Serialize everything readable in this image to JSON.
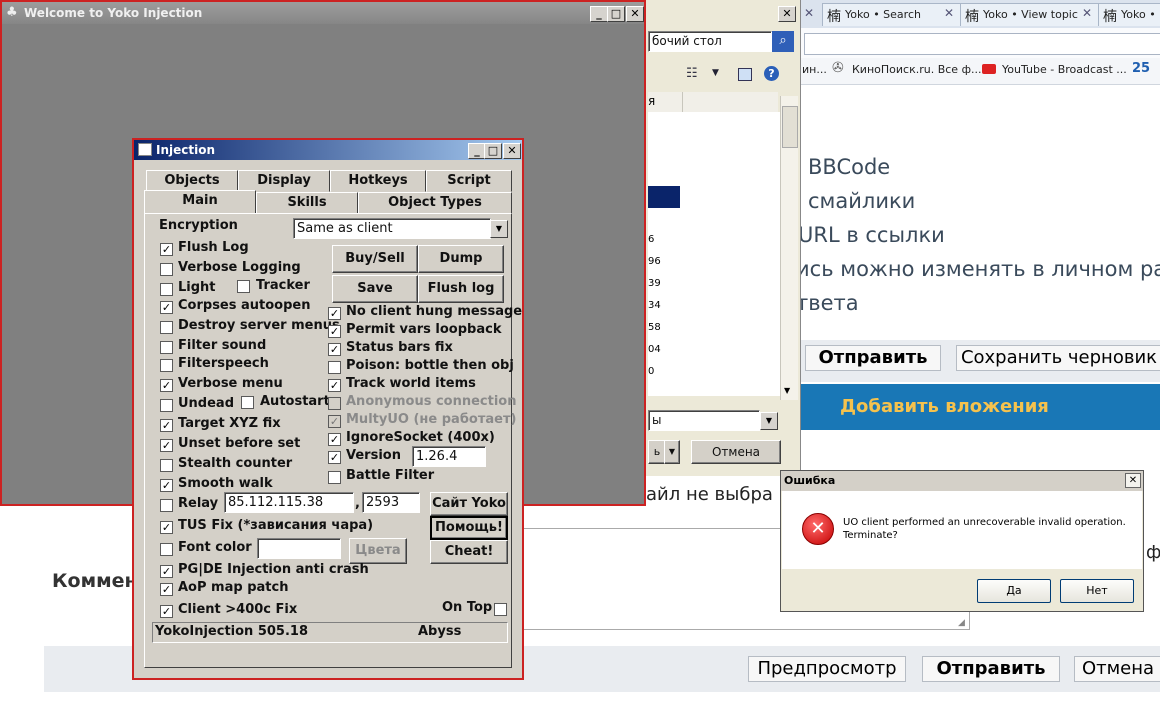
{
  "browser": {
    "tabs": [
      {
        "icon": "楠",
        "label": "Yoko • Search"
      },
      {
        "icon": "楠",
        "label": "Yoko • View topic"
      },
      {
        "icon": "楠",
        "label": "Yoko • "
      }
    ],
    "bookmarks": [
      "ин...",
      "КиноПоиск.ru. Все ф...",
      "YouTube - Broadcast ...",
      "25"
    ],
    "forum_lines": [
      "BBCode",
      "смайлики",
      "URL в ссылки",
      "ись можно изменять в личном раз",
      "твета"
    ],
    "submit_button": "Отправить",
    "draft_button": "Сохранить черновик",
    "attach_label": "Добавить вложения",
    "file_not_selected": "айл не выбра",
    "comment_label": "Коммен",
    "right_edge_text": "ф",
    "preview_button": "Предпросмотр",
    "send_button": "Отправить",
    "cancel_button": "Отмена"
  },
  "explorer": {
    "path_text": "бочий стол",
    "col_header": "я",
    "rows": [
      "6",
      "96",
      "39",
      "34",
      "58",
      "04",
      "0"
    ],
    "dropdown_text": "ы",
    "cancel_button": "Отмена",
    "small_dropdown": "ь"
  },
  "welcome": {
    "title": "Welcome to Yoko Injection"
  },
  "injection": {
    "title": "Injection",
    "tabs_row1": [
      "Objects",
      "Display",
      "Hotkeys",
      "Script"
    ],
    "tabs_row2": [
      "Main",
      "Skills",
      "Object Types"
    ],
    "encryption_label": "Encryption",
    "encryption_value": "Same as client",
    "left_checks": [
      {
        "label": "Flush Log",
        "checked": true
      },
      {
        "label": "Verbose Logging",
        "checked": false
      },
      {
        "label": "Light",
        "checked": false
      },
      {
        "label": "Corpses autoopen",
        "checked": true
      },
      {
        "label": "Destroy server menus",
        "checked": false
      },
      {
        "label": "Filter sound",
        "checked": false
      },
      {
        "label": "Filterspeech",
        "checked": false
      },
      {
        "label": "Verbose menu",
        "checked": true
      },
      {
        "label": "Undead",
        "checked": false
      },
      {
        "label": "Target XYZ fix",
        "checked": true
      },
      {
        "label": "Unset before set",
        "checked": true
      },
      {
        "label": "Stealth counter",
        "checked": false
      },
      {
        "label": "Smooth walk",
        "checked": true
      }
    ],
    "tracker": {
      "label": "Tracker",
      "checked": false
    },
    "autostart": {
      "label": "Autostart",
      "checked": false
    },
    "buttons": {
      "buysell": "Buy/Sell",
      "dump": "Dump",
      "save": "Save",
      "flushlog": "Flush log"
    },
    "right_checks": [
      {
        "label": "No client hung message",
        "checked": true,
        "disabled": false
      },
      {
        "label": "Permit vars loopback",
        "checked": true,
        "disabled": false
      },
      {
        "label": "Status bars fix",
        "checked": true,
        "disabled": false
      },
      {
        "label": "Poison: bottle then obj",
        "checked": false,
        "disabled": false
      },
      {
        "label": "Track world items",
        "checked": true,
        "disabled": false
      },
      {
        "label": "Anonymous connection",
        "checked": false,
        "disabled": true
      },
      {
        "label": "MultyUO (не работает)",
        "checked": true,
        "disabled": true
      },
      {
        "label": "IgnoreSocket (400x)",
        "checked": true,
        "disabled": false
      }
    ],
    "version": {
      "label": "Version",
      "checked": true,
      "value": "1.26.4"
    },
    "battle_filter": {
      "label": "Battle Filter",
      "checked": false
    },
    "relay": {
      "label": "Relay",
      "checked": false,
      "ip": "85.112.115.38",
      "sep": ",",
      "port": "2593"
    },
    "site_button": "Сайт Yoko",
    "help_button": "Помощь!",
    "cheat_button": "Cheat!",
    "tus_fix": {
      "label": "TUS Fix (*зависания чара)",
      "checked": true
    },
    "font_color": {
      "label": "Font color",
      "checked": false,
      "button": "Цвета"
    },
    "pgde": {
      "label": "PG|DE Injection anti crash",
      "checked": true
    },
    "aop": {
      "label": "AoP map patch",
      "checked": true
    },
    "client400": {
      "label": "Client >400c Fix",
      "checked": true
    },
    "on_top": {
      "label": "On Top",
      "checked": false
    },
    "status_left": "YokoInjection 505.18",
    "status_right": "Abyss"
  },
  "error_dialog": {
    "title": "Ошибка",
    "message_line1": "UO client performed an unrecoverable invalid operation.",
    "message_line2": "Terminate?",
    "yes": "Да",
    "no": "Нет"
  },
  "colors": {
    "accent_red": "#cc2222",
    "titlebar_blue": "#0a246a",
    "web_blue": "#1977b6"
  }
}
